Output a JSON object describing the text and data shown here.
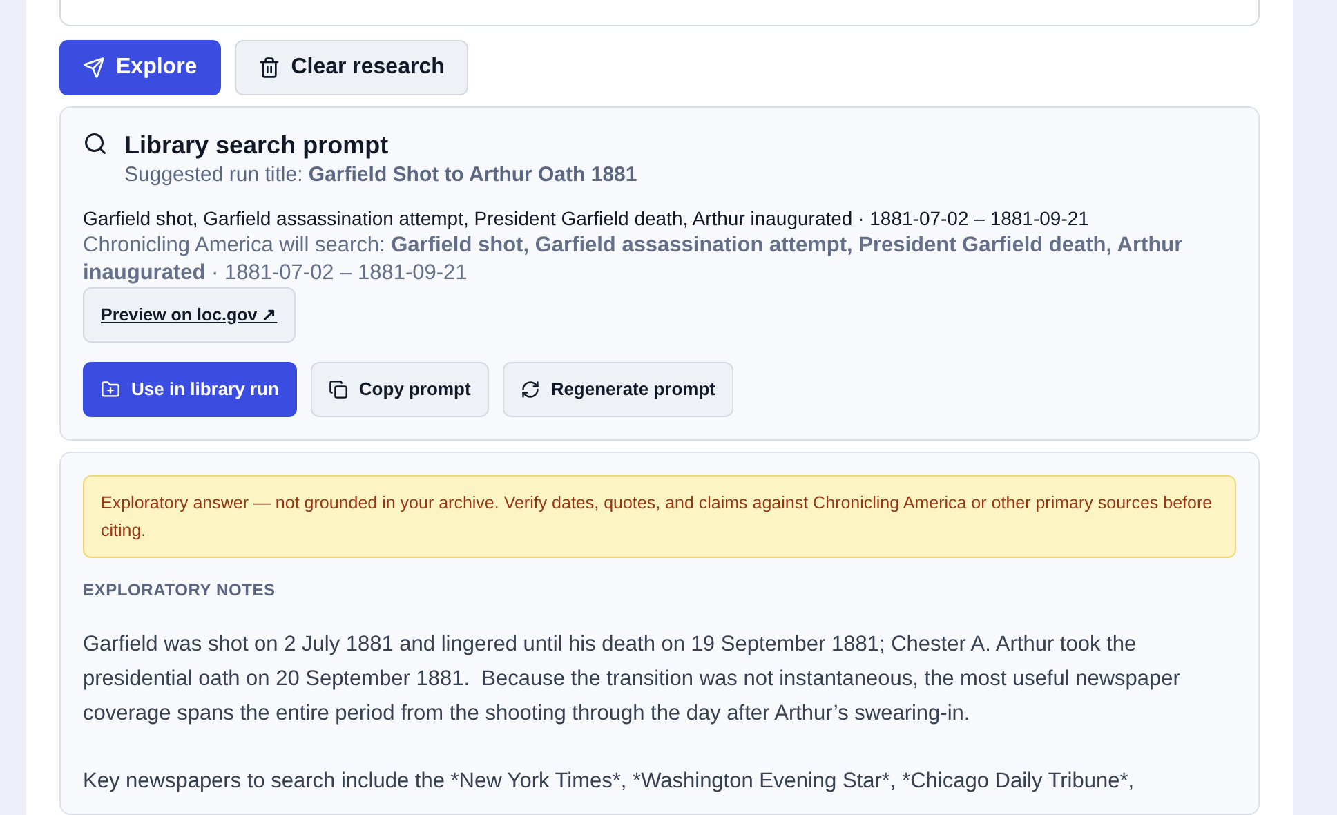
{
  "actions": [
    {
      "kind": "primary",
      "label": "Explore"
    },
    {
      "kind": "secondary",
      "label": "Clear research"
    }
  ],
  "prompt_card": {
    "title": "Library search prompt",
    "run_title": "Suggested run title: **Garfield Shot to Arthur Oath 1881**",
    "query": "Garfield shot, Garfield assassination attempt, President Garfield death, Arthur inaugurated · 1881-07-02 – 1881-09-21",
    "search_line": "Chronicling America will search: **Garfield shot, Garfield assassination attempt, President Garfield death, Arthur inaugurated** · 1881-07-02 – 1881-09-21",
    "preview_link": "Preview on loc.gov ↗",
    "buttons": [
      {
        "kind": "primary",
        "label": "Use in library run"
      },
      {
        "kind": "secondary",
        "label": "Copy prompt"
      },
      {
        "kind": "secondary",
        "label": "Regenerate prompt"
      }
    ]
  },
  "notes_card": {
    "warning": "Exploratory answer — not grounded in your archive. Verify dates, quotes, and claims against Chronicling America or other primary sources before citing.",
    "heading": "EXPLORATORY NOTES",
    "paragraphs": [
      "Garfield was shot on 2 July 1881 and lingered until his death on 19 September 1881; Chester A. Arthur took the presidential oath on 20 September 1881.  Because the transition was not instantaneous, the most useful newspaper coverage spans the entire period from the shooting through the day after Arthur’s swearing-in.",
      "Key newspapers to search include the *New York Times*, *Washington Evening Star*, *Chicago Daily Tribune*,"
    ]
  }
}
